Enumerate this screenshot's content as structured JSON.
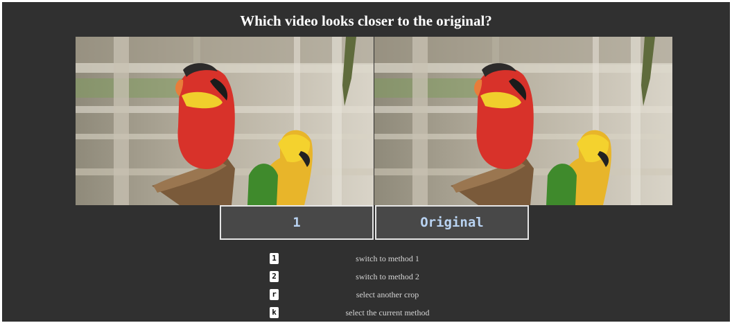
{
  "page": {
    "title": "Which video looks closer to the original?"
  },
  "labels": {
    "left": "1",
    "right": "Original"
  },
  "shortcuts": [
    {
      "key": "1",
      "description": "switch to method 1"
    },
    {
      "key": "2",
      "description": "switch to method 2"
    },
    {
      "key": "r",
      "description": "select another crop"
    },
    {
      "key": "k",
      "description": "select the current method"
    }
  ],
  "colors": {
    "background": "#303030",
    "label_text": "#b9d3f2",
    "label_bg": "#484848"
  }
}
